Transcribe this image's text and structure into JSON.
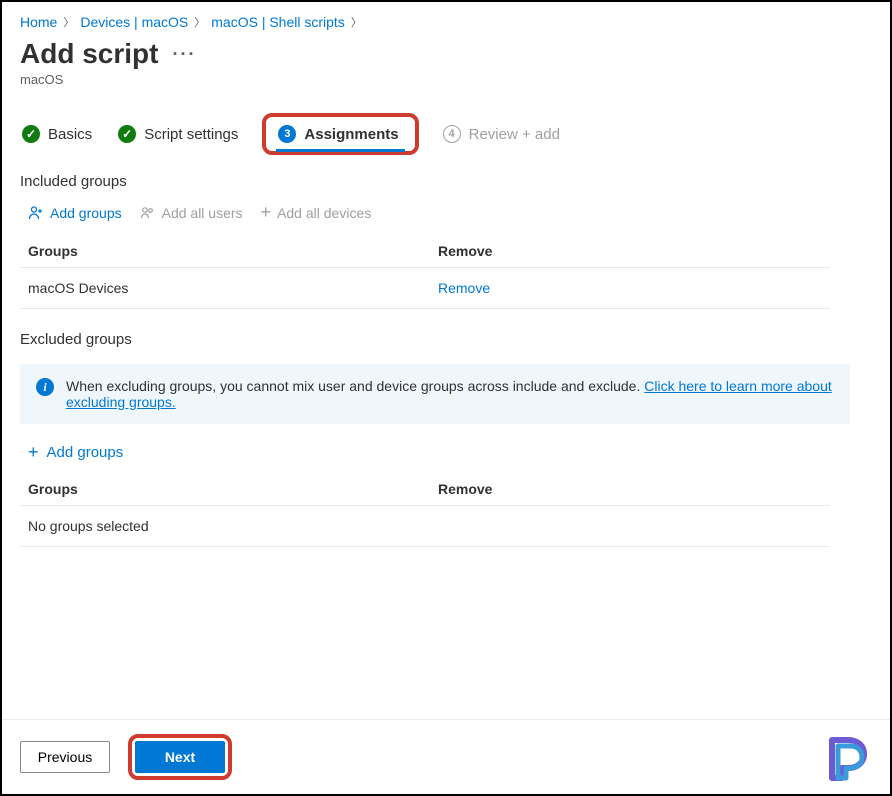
{
  "breadcrumb": {
    "items": [
      "Home",
      "Devices | macOS",
      "macOS | Shell scripts"
    ]
  },
  "header": {
    "title": "Add script",
    "subtitle": "macOS"
  },
  "tabs": {
    "basics": "Basics",
    "script_settings": "Script settings",
    "assignments_num": "3",
    "assignments": "Assignments",
    "review_num": "4",
    "review": "Review + add"
  },
  "included": {
    "heading": "Included groups",
    "add_groups": "Add groups",
    "add_all_users": "Add all users",
    "add_all_devices": "Add all devices",
    "col_groups": "Groups",
    "col_remove": "Remove",
    "rows": [
      {
        "name": "macOS Devices",
        "remove": "Remove"
      }
    ]
  },
  "excluded": {
    "heading": "Excluded groups",
    "info_text": "When excluding groups, you cannot mix user and device groups across include and exclude. ",
    "info_link": "Click here to learn more about excluding groups.",
    "add_groups": "Add groups",
    "col_groups": "Groups",
    "col_remove": "Remove",
    "empty": "No groups selected"
  },
  "footer": {
    "previous": "Previous",
    "next": "Next"
  }
}
